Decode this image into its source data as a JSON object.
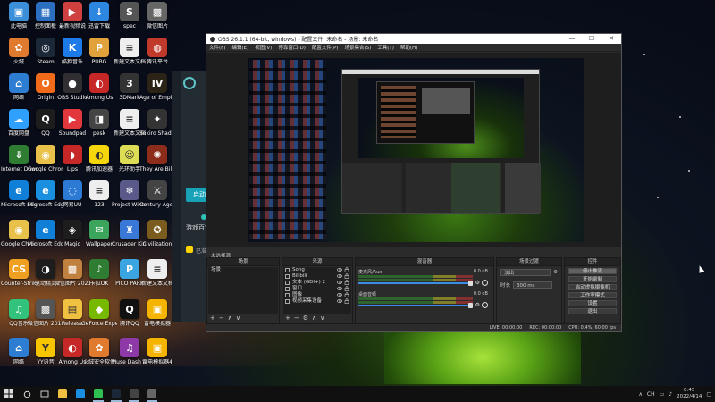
{
  "desktop": {
    "icons": [
      {
        "label": "此电脑",
        "color": "#3a8fd8",
        "glyph": "▣"
      },
      {
        "label": "控制面板",
        "color": "#2a6fc0",
        "glyph": "▦"
      },
      {
        "label": "最新视频说",
        "color": "#d04040",
        "glyph": "▶"
      },
      {
        "label": "迅雷下载",
        "color": "#2d86e0",
        "glyph": "↓"
      },
      {
        "label": "spec",
        "color": "#555",
        "glyph": "S"
      },
      {
        "label": "微信图片",
        "color": "#666",
        "glyph": "▩"
      },
      {
        "label": "火绒",
        "color": "#e07a2f",
        "glyph": "✿"
      },
      {
        "label": "Steam",
        "color": "#1b2838",
        "glyph": "◎"
      },
      {
        "label": "酷狗音乐",
        "color": "#1c7be8",
        "glyph": "K"
      },
      {
        "label": "PUBG",
        "color": "#e2a23b",
        "glyph": "P"
      },
      {
        "label": "新建文本文档",
        "color": "#eee",
        "glyph": "≡"
      },
      {
        "label": "腾讯平台",
        "color": "#c0392b",
        "glyph": "◍"
      },
      {
        "label": "网络",
        "color": "#2d7dd2",
        "glyph": "⌂"
      },
      {
        "label": "Origin",
        "color": "#f06a1a",
        "glyph": "O"
      },
      {
        "label": "OBS Studio",
        "color": "#302e31",
        "glyph": "●"
      },
      {
        "label": "Among Us",
        "color": "#c62828",
        "glyph": "◐"
      },
      {
        "label": "3DMark",
        "color": "#333",
        "glyph": "3"
      },
      {
        "label": "Age of Empires IV",
        "color": "#2b2416",
        "glyph": "IV"
      },
      {
        "label": "百度网盘",
        "color": "#2fa0ff",
        "glyph": "☁"
      },
      {
        "label": "QQ",
        "color": "#1d1d1d",
        "glyph": "Q"
      },
      {
        "label": "Soundpad",
        "color": "#e2383d",
        "glyph": "▶"
      },
      {
        "label": "pesk",
        "color": "#444",
        "glyph": "◨"
      },
      {
        "label": "新建文本文档",
        "color": "#eee",
        "glyph": "≡"
      },
      {
        "label": "Sekiro Shadows",
        "color": "#333",
        "glyph": "✦"
      },
      {
        "label": "Internet Download",
        "color": "#2e7d32",
        "glyph": "⇓"
      },
      {
        "label": "Google Chrome",
        "color": "#e8c14a",
        "glyph": "◉"
      },
      {
        "label": "Lips",
        "color": "#c62828",
        "glyph": "◗"
      },
      {
        "label": "腾讯加速器",
        "color": "#f5d60b",
        "glyph": "◐"
      },
      {
        "label": "光环助手",
        "color": "#dddd55",
        "glyph": "☺"
      },
      {
        "label": "They Are Billions",
        "color": "#8b2d1a",
        "glyph": "✺"
      },
      {
        "label": "Microsoft Edge",
        "color": "#0f7fd8",
        "glyph": "e"
      },
      {
        "label": "Microsoft Edge",
        "color": "#1a8fe0",
        "glyph": "e"
      },
      {
        "label": "网易UU",
        "color": "#2c7ad4",
        "glyph": "◌"
      },
      {
        "label": "123",
        "color": "#eee",
        "glyph": "≡"
      },
      {
        "label": "Project Winter",
        "color": "#5a5a8a",
        "glyph": "❄"
      },
      {
        "label": "Century Age of Empires",
        "color": "#444",
        "glyph": "⚔"
      },
      {
        "label": "Google Chrome",
        "color": "#e8c14a",
        "glyph": "◉"
      },
      {
        "label": "Microsoft Edge",
        "color": "#0f7fd8",
        "glyph": "e"
      },
      {
        "label": "Magic",
        "color": "#1d1d1d",
        "glyph": "◈"
      },
      {
        "label": "Wallpaper",
        "color": "#3ba55c",
        "glyph": "✉"
      },
      {
        "label": "Crusader Kings",
        "color": "#3978d6",
        "glyph": "♜"
      },
      {
        "label": "Civilization",
        "color": "#7a5c1e",
        "glyph": "✪"
      },
      {
        "label": "Counter-Strike Global Off",
        "color": "#f0a020",
        "glyph": "CS"
      },
      {
        "label": "驱动精灵",
        "color": "#1d1d1d",
        "glyph": "◑"
      },
      {
        "label": "微信图片 20210108",
        "color": "#c08040",
        "glyph": "▩"
      },
      {
        "label": "卡拉OK",
        "color": "#2e7d32",
        "glyph": "♪"
      },
      {
        "label": "PICO PARK",
        "color": "#3aa5e0",
        "glyph": "P"
      },
      {
        "label": "新建文本文档",
        "color": "#eee",
        "glyph": "≡"
      },
      {
        "label": "QQ音乐",
        "color": "#31c27c",
        "glyph": "♫"
      },
      {
        "label": "微信图片 20181101",
        "color": "#555",
        "glyph": "▩"
      },
      {
        "label": "Release",
        "color": "#f0c040",
        "glyph": "▤"
      },
      {
        "label": "GeForce Experience",
        "color": "#76b900",
        "glyph": "◆"
      },
      {
        "label": "腾讯QQ",
        "color": "#111",
        "glyph": "Q"
      },
      {
        "label": "雷电模拟器",
        "color": "#f5b400",
        "glyph": "▣"
      },
      {
        "label": "网络",
        "color": "#2d7dd2",
        "glyph": "⌂"
      },
      {
        "label": "YY语音",
        "color": "#f7c600",
        "glyph": "Y"
      },
      {
        "label": "Among Us",
        "color": "#c62828",
        "glyph": "◐"
      },
      {
        "label": "火绒安全软件",
        "color": "#e07a2f",
        "glyph": "✿"
      },
      {
        "label": "Muse Dash Marvelling",
        "color": "#8d3aa8",
        "glyph": "♫"
      },
      {
        "label": "雷电模拟器4",
        "color": "#f5b400",
        "glyph": "▣"
      }
    ]
  },
  "bg_app": {
    "button": "启动",
    "text": "游戏百宝",
    "subtext": "已准备"
  },
  "obs": {
    "title": "OBS 26.1.1 (64-bit, windows) - 配置文件: 未命名 - 场景: 未命名",
    "window_controls": {
      "minimize": "—",
      "maximize": "☐",
      "close": "✕"
    },
    "menu": [
      "文件(F)",
      "编辑(E)",
      "视图(V)",
      "停靠窗口(D)",
      "配置文件(P)",
      "场景集合(S)",
      "工具(T)",
      "帮助(H)"
    ],
    "scene_label": "未选择源",
    "docks": {
      "scenes": {
        "title": "场景",
        "items": [
          "场景"
        ]
      },
      "sources": {
        "title": "来源",
        "items": [
          "Song",
          "Bilibili",
          "文本 (GDI+) 2",
          "窗口",
          "图像",
          "视频采集设备"
        ]
      },
      "mixer": {
        "title": "混音器",
        "tracks": [
          {
            "name": "麦克风/Aux",
            "db": "0.0 dB"
          },
          {
            "name": "桌面音频",
            "db": "0.0 dB"
          }
        ]
      },
      "transitions": {
        "title": "场景过渡",
        "type": "淡出",
        "duration_label": "时长",
        "duration": "300 ms"
      },
      "controls": {
        "title": "控件",
        "buttons": [
          "停止推流",
          "开始录制",
          "启动虚拟摄像机",
          "工作室模式",
          "设置",
          "退出"
        ]
      }
    },
    "status": {
      "live": "LIVE: 00:00:00",
      "rec": "REC: 00:00:00",
      "cpu": "CPU: 0.4%, 60.00 fps"
    },
    "dock_tools": [
      "+",
      "−",
      "∧",
      "∨"
    ],
    "source_tools": [
      "+",
      "−",
      "⚙",
      "∧",
      "∨"
    ]
  },
  "taskbar": {
    "apps": [
      {
        "name": "file-explorer",
        "color": "#f0c040"
      },
      {
        "name": "edge",
        "color": "#1a8fe0"
      },
      {
        "name": "wechat",
        "color": "#2ec050"
      },
      {
        "name": "steam",
        "color": "#1b2838"
      },
      {
        "name": "obs",
        "color": "#444"
      },
      {
        "name": "obs-2",
        "color": "#666"
      }
    ],
    "tray": {
      "lang": "CH",
      "time": "8:45",
      "date": "2022/4/14"
    }
  }
}
